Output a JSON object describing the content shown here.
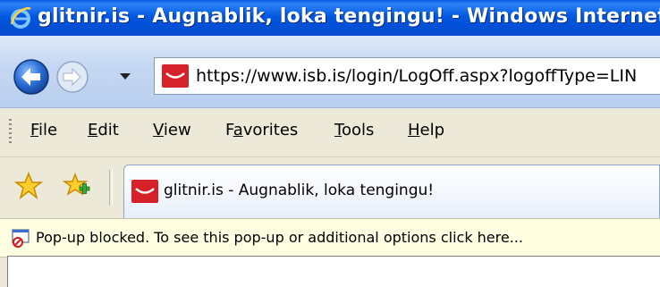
{
  "window": {
    "title": "glitnir.is - Augnablik, loka tengingu! - Windows Internet"
  },
  "navigation": {
    "back_icon": "back-arrow-icon",
    "forward_icon": "forward-arrow-icon",
    "recent_pages_icon": "chevron-down-icon",
    "address": "https://www.isb.is/login/LogOff.aspx?logoffType=LIN",
    "site_icon": "glitnir-favicon"
  },
  "menu": {
    "items": [
      {
        "label": "File",
        "accel": "F",
        "rest": "ile"
      },
      {
        "label": "Edit",
        "accel": "E",
        "rest": "dit"
      },
      {
        "label": "View",
        "accel": "V",
        "rest": "iew"
      },
      {
        "label": "Favorites",
        "pre": "F",
        "accel": "a",
        "rest": "vorites"
      },
      {
        "label": "Tools",
        "accel": "T",
        "rest": "ools"
      },
      {
        "label": "Help",
        "accel": "H",
        "rest": "elp"
      }
    ]
  },
  "tabs": {
    "favorites_icon": "star-icon",
    "add_favorites_icon": "add-to-favorites-icon",
    "active_tab_label": "glitnir.is - Augnablik, loka tengingu!"
  },
  "infobar": {
    "icon": "popup-blocked-icon",
    "message": "Pop-up blocked. To see this pop-up or additional options click here..."
  },
  "colors": {
    "title_bar": "#0054e3",
    "infobar_bg": "#ffffe1",
    "glitnir_red": "#d6202a"
  }
}
